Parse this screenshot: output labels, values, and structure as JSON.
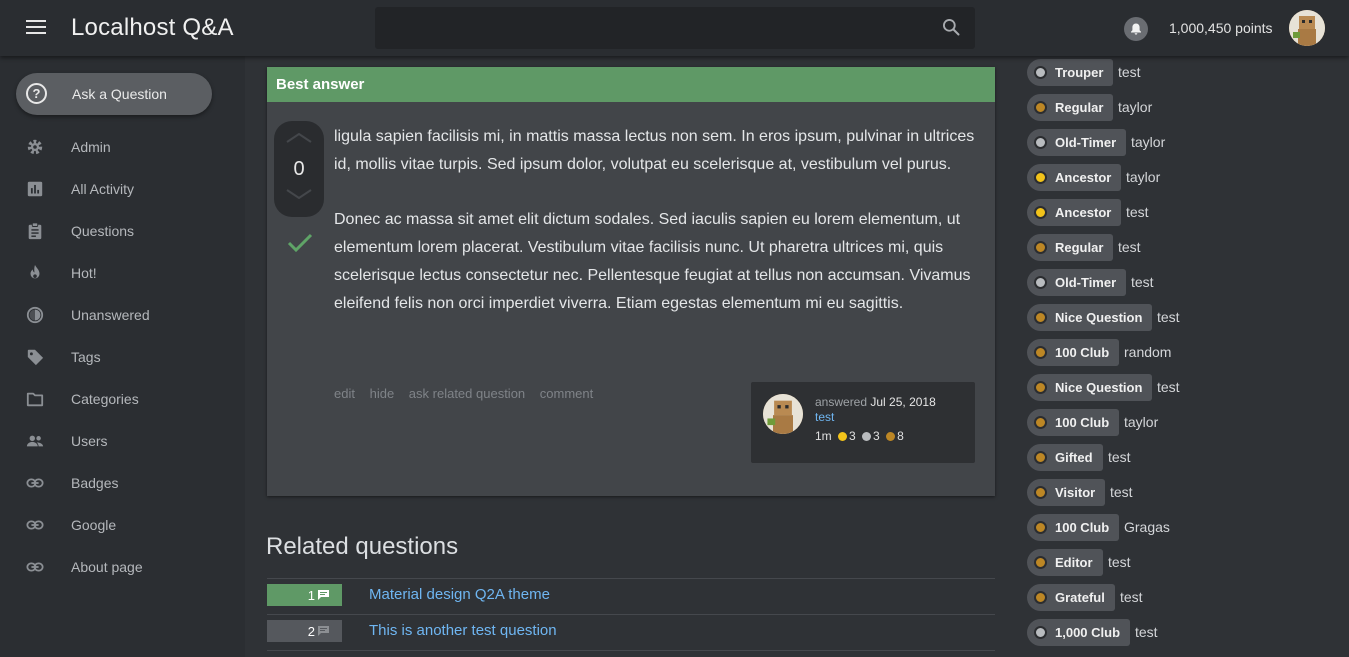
{
  "app": {
    "title": "Localhost Q&A"
  },
  "header": {
    "points": "1,000,450 points",
    "search_placeholder": ""
  },
  "sidebar": {
    "ask_label": "Ask a Question",
    "items": [
      {
        "label": "Admin",
        "icon": "gear-icon"
      },
      {
        "label": "All Activity",
        "icon": "activity-chart-icon"
      },
      {
        "label": "Questions",
        "icon": "clipboard-icon"
      },
      {
        "label": "Hot!",
        "icon": "flame-icon"
      },
      {
        "label": "Unanswered",
        "icon": "half-circle-icon"
      },
      {
        "label": "Tags",
        "icon": "tag-icon"
      },
      {
        "label": "Categories",
        "icon": "folder-icon"
      },
      {
        "label": "Users",
        "icon": "users-icon"
      },
      {
        "label": "Badges",
        "icon": "link-icon"
      },
      {
        "label": "Google",
        "icon": "link-icon"
      },
      {
        "label": "About page",
        "icon": "link-icon"
      }
    ]
  },
  "answer": {
    "header": "Best answer",
    "votes": "0",
    "paragraphs": [
      "ligula sapien facilisis mi, in mattis massa lectus non sem. In eros ipsum, pulvinar in ultrices id, mollis vitae turpis. Sed ipsum dolor, volutpat eu scelerisque at, vestibulum vel purus.",
      "Donec ac massa sit amet elit dictum sodales. Sed iaculis sapien eu lorem elementum, ut elementum lorem placerat. Vestibulum vitae facilisis nunc. Ut pharetra ultrices mi, quis scelerisque lectus consectetur nec. Pellentesque feugiat at tellus non accumsan. Vivamus eleifend felis non orci imperdiet viverra. Etiam egestas elementum mi eu sagittis."
    ],
    "actions": [
      "edit",
      "hide",
      "ask related question",
      "comment"
    ],
    "meta": {
      "answered_label": "answered",
      "date": "Jul 25, 2018",
      "user": "test",
      "points": "1m",
      "gold": "3",
      "silver": "3",
      "bronze": "8"
    }
  },
  "related": {
    "title": "Related questions",
    "items": [
      {
        "count": "1",
        "title": "Material design Q2A theme",
        "answered": true
      },
      {
        "count": "2",
        "title": "This is another test question",
        "answered": false
      }
    ]
  },
  "badges": [
    {
      "name": "Trouper",
      "tier": "silver",
      "user": "test"
    },
    {
      "name": "Regular",
      "tier": "bronze",
      "user": "taylor"
    },
    {
      "name": "Old-Timer",
      "tier": "silver",
      "user": "taylor"
    },
    {
      "name": "Ancestor",
      "tier": "gold",
      "user": "taylor"
    },
    {
      "name": "Ancestor",
      "tier": "gold",
      "user": "test"
    },
    {
      "name": "Regular",
      "tier": "bronze",
      "user": "test"
    },
    {
      "name": "Old-Timer",
      "tier": "silver",
      "user": "test"
    },
    {
      "name": "Nice Question",
      "tier": "bronze",
      "user": "test"
    },
    {
      "name": "100 Club",
      "tier": "bronze",
      "user": "random"
    },
    {
      "name": "Nice Question",
      "tier": "bronze",
      "user": "test"
    },
    {
      "name": "100 Club",
      "tier": "bronze",
      "user": "taylor"
    },
    {
      "name": "Gifted",
      "tier": "bronze",
      "user": "test"
    },
    {
      "name": "Visitor",
      "tier": "bronze",
      "user": "test"
    },
    {
      "name": "100 Club",
      "tier": "bronze",
      "user": "Gragas"
    },
    {
      "name": "Editor",
      "tier": "bronze",
      "user": "test"
    },
    {
      "name": "Grateful",
      "tier": "bronze",
      "user": "test"
    },
    {
      "name": "1,000 Club",
      "tier": "silver",
      "user": "test"
    }
  ],
  "colors": {
    "gold": "#f2c31a",
    "silver": "#b9bcbf",
    "bronze": "#bd8725",
    "accent_green": "#5f9966",
    "link": "#6fb6f2"
  }
}
